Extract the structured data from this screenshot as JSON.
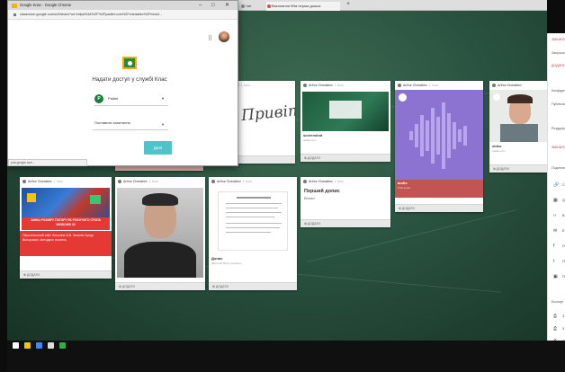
{
  "browser": {
    "tabs": [
      {
        "label": "Чат",
        "color": "#888888"
      },
      {
        "label": "Виконання 9бм перша дошка",
        "color": "#d94a4a"
      }
    ],
    "new_tab": "+"
  },
  "popup": {
    "title": "Google Клас - Google Chrome",
    "controls": {
      "minimize": "–",
      "maximize": "□",
      "close": "✕"
    },
    "url": "classroom.google.com/u/0/share?url=https%3A%2F%2Fpadlet.com%2Fchedaliev%2Fbest4...",
    "share_title": "Надати доступ у службі Клас",
    "class_select": {
      "avatar_letter": "P",
      "value": "Padlet"
    },
    "action_select": {
      "value": "Поставити запитання"
    },
    "go_label": "Далі",
    "status_url": "pda.google.com..."
  },
  "padlet": {
    "cards": [
      {
        "author": "Arthur Chedaliev",
        "time": "1 hour",
        "title": "",
        "subtitle": "",
        "handwriting": "Привіт",
        "footer": "ДОДАТИ"
      },
      {
        "author": "Arthur Chedaliev",
        "time": "1 hour",
        "title": "screenshot",
        "subtitle": "padlet.com",
        "footer": "ДОДАТИ"
      },
      {
        "author": "Arthur Chedaliev",
        "time": "1 hour",
        "title": "audio",
        "subtitle": "0:20 audio",
        "footer": "ДОДАТИ"
      },
      {
        "author": "Arthur Chedaliev",
        "time": "1 hour",
        "title": "video",
        "subtitle": "padlet.com",
        "footer": "ДОДАТИ"
      },
      {
        "author": "Arthur Chedaliev",
        "time": "1 hour",
        "banner": "ЗМІНА РОЗМІРУ ПАТОРУ ЯК РОБОЧОГО СТОЛА WINDOWS 10",
        "title": "Персональний сайт Чеколіна А.В. Чеколін Артур Вікторович, методист, вчитель",
        "footer": "ДОДАТИ"
      },
      {
        "author": "Arthur Chedaliev",
        "time": "1 hour",
        "footer": "ДОДАТИ"
      },
      {
        "author": "Arthur Chedaliev",
        "time": "1 hour",
        "title": "Допис",
        "subtitle": "Microsoft Word документ",
        "footer": "ДОДАТИ"
      },
      {
        "author": "Arthur Chedaliev",
        "time": "1 hour",
        "title": "Перший допис",
        "subtitle": "Вітаю!",
        "footer": "ДОДАТИ"
      }
    ]
  },
  "right_panel": {
    "items": [
      {
        "text": "ЗМІНИТИ",
        "red": true
      },
      {
        "text": "Запрошення",
        "red": false
      },
      {
        "text": "ДОДАТИ",
        "red": true
      },
      {
        "text": "Конфіденційність",
        "red": false
      },
      {
        "text": "Публічна",
        "red": false
      },
      {
        "text": "Роздрукувати",
        "red": false
      },
      {
        "text": "ЗМІНИТИ",
        "red": true
      },
      {
        "text": "Поділитися",
        "red": false
      }
    ],
    "share_items": [
      {
        "icon": "🔗",
        "label": "С"
      },
      {
        "icon": "▦",
        "label": "Q"
      },
      {
        "icon": "‹›",
        "label": "В"
      },
      {
        "icon": "✉",
        "label": "Е"
      },
      {
        "icon": "f",
        "label": "П"
      },
      {
        "icon": "t",
        "label": "П"
      },
      {
        "icon": "▣",
        "label": "П"
      }
    ],
    "export_label": "Експорт",
    "export_items": [
      "З",
      "З",
      "З"
    ]
  },
  "taskbar": {
    "icons": [
      {
        "color": "#ffffff"
      },
      {
        "color": "#f5c400"
      },
      {
        "color": "#4285f4"
      },
      {
        "color": "#dddddd"
      },
      {
        "color": "#34a853"
      }
    ]
  }
}
